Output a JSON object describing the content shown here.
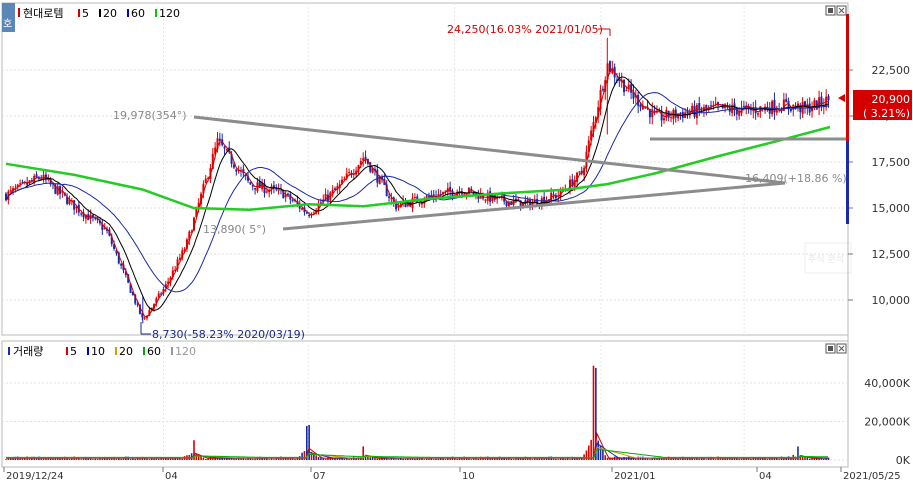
{
  "app": {
    "corner_badge": "호"
  },
  "price_panel": {
    "title": "현대로템",
    "legend": [
      {
        "label": "5",
        "color": "#d40000"
      },
      {
        "label": "20",
        "color": "#000000"
      },
      {
        "label": "60",
        "color": "#0000cc"
      },
      {
        "label": "120",
        "color": "#00cc00"
      }
    ],
    "current_price": "20,900",
    "current_change": "( 3.21%)",
    "annotations": {
      "high": "24,250(16.03% 2021/01/05)",
      "low": "8,730(-58.23% 2020/03/19)",
      "triangle_top": "19,978(354°)",
      "triangle_bottom": "13,890(  5°)",
      "triangle_apex": "16,409(+18.86 %)"
    },
    "watermark": "주식 분석"
  },
  "volume_panel": {
    "title": "거래량",
    "legend": [
      {
        "label": "5",
        "color": "#d40000"
      },
      {
        "label": "10",
        "color": "#0000cc"
      },
      {
        "label": "20",
        "color": "#d4a000"
      },
      {
        "label": "60",
        "color": "#00aa00"
      },
      {
        "label": "120",
        "color": "#999999"
      }
    ]
  },
  "chart_data": [
    {
      "type": "candlestick",
      "title": "현대로템",
      "x_range": [
        "2019-12-24",
        "2021-05-25"
      ],
      "ylim": [
        8000,
        26000
      ],
      "y_ticks": [
        "10,000",
        "12,500",
        "15,000",
        "17,500",
        "20,000",
        "22,500"
      ],
      "y_tick_values": [
        10000,
        12500,
        15000,
        17500,
        20000,
        22500
      ],
      "moving_averages": [
        "5",
        "20",
        "60",
        "120"
      ],
      "close_series": {
        "x": [
          "2019-12-24",
          "2020-01-15",
          "2020-02-05",
          "2020-02-25",
          "2020-03-19",
          "2020-04-02",
          "2020-04-15",
          "2020-05-05",
          "2020-05-25",
          "2020-06-15",
          "2020-07-01",
          "2020-07-20",
          "2020-08-05",
          "2020-08-25",
          "2020-09-15",
          "2020-10-05",
          "2020-10-25",
          "2020-11-15",
          "2020-12-05",
          "2020-12-20",
          "2021-01-05",
          "2021-01-20",
          "2021-02-05",
          "2021-02-25",
          "2021-03-15",
          "2021-04-05",
          "2021-04-25",
          "2021-05-10",
          "2021-05-25"
        ],
        "y": [
          15700,
          16700,
          15100,
          13800,
          8900,
          10700,
          12900,
          18600,
          16300,
          15800,
          14700,
          16100,
          17800,
          15100,
          15600,
          16000,
          15500,
          15200,
          15700,
          16900,
          22800,
          21200,
          19900,
          20200,
          20400,
          20300,
          20600,
          20400,
          20900
        ]
      },
      "ma120": {
        "x": [
          "2019-12-24",
          "2020-02-05",
          "2020-03-19",
          "2020-04-20",
          "2020-05-25",
          "2020-07-01",
          "2020-08-05",
          "2020-09-15",
          "2020-11-01",
          "2020-12-10",
          "2021-01-05",
          "2021-02-05",
          "2021-03-15",
          "2021-04-20",
          "2021-05-25"
        ],
        "y": [
          17400,
          16800,
          16000,
          15000,
          14900,
          15200,
          15100,
          15500,
          15800,
          16000,
          16300,
          16900,
          17800,
          18600,
          19400
        ]
      },
      "annotations": [
        {
          "label": "24,250(16.03% 2021/01/05)",
          "x": "2021-01-05",
          "y": 24250
        },
        {
          "label": "8,730(-58.23% 2020/03/19)",
          "x": "2020-03-19",
          "y": 8730
        },
        {
          "label": "19,978(354°)",
          "x": "2020-04-20",
          "y": 19978
        },
        {
          "label": "13,890(  5°)",
          "x": "2020-06-15",
          "y": 13890
        },
        {
          "label": "16,409(+18.86 %)",
          "x": "2021-05-25",
          "y": 16409
        }
      ],
      "current_value": {
        "price": 20900,
        "change_pct": 3.21
      }
    },
    {
      "type": "bar",
      "title": "거래량",
      "x_range": [
        "2019-12-24",
        "2021-05-25"
      ],
      "x_ticks": [
        "2019/12/24",
        "04",
        "07",
        "10",
        "2021/01",
        "04",
        "2021/05/25"
      ],
      "ylim": [
        0,
        55000
      ],
      "y_ticks": [
        "0K",
        "20,000K",
        "40,000K"
      ],
      "y_tick_values": [
        0,
        20000,
        40000
      ],
      "moving_averages": [
        "5",
        "10",
        "20",
        "60",
        "120"
      ],
      "spikes": [
        {
          "x": "2020-04-20",
          "y": 10000
        },
        {
          "x": "2020-07-01",
          "y": 19000
        },
        {
          "x": "2020-08-05",
          "y": 6500
        },
        {
          "x": "2020-12-28",
          "y": 53000
        },
        {
          "x": "2021-05-05",
          "y": 6000
        }
      ]
    }
  ]
}
